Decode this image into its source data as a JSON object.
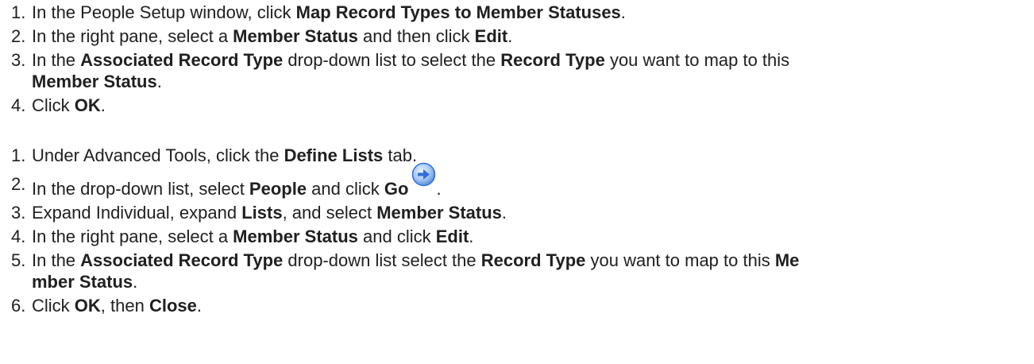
{
  "procedure_1": {
    "step_1": {
      "num": "1.",
      "a": "In the People Setup window, click ",
      "b1": "Map Record Types to Member Statuses",
      "c": "."
    },
    "step_2": {
      "num": "2.",
      "a": "In the right pane, select a ",
      "b1": "Member Status",
      "c": " and then click ",
      "b2": "Edit",
      "d": "."
    },
    "step_3": {
      "num": "3.",
      "a": "In the ",
      "b1": "Associated Record Type",
      "c": " drop-down list to select the ",
      "b2": "Record Type",
      "d": " you want to map to this ",
      "b3": "Member Status",
      "e": "."
    },
    "step_4": {
      "num": "4.",
      "a": "Click ",
      "b1": "OK",
      "c": "."
    }
  },
  "procedure_2": {
    "step_1": {
      "num": "1.",
      "a": "Under Advanced Tools, click the ",
      "b1": "Define Lists",
      "c": " tab."
    },
    "step_2": {
      "num": "2.",
      "a": "In the drop-down list, select ",
      "b1": "People",
      "c": " and click ",
      "b2": "Go",
      "d": "."
    },
    "step_3": {
      "num": "3.",
      "a": "Expand Individual, expand ",
      "b1": "Lists",
      "c": ", and select ",
      "b2": "Member Status",
      "d": "."
    },
    "step_4": {
      "num": "4.",
      "a": "In the right pane, select a ",
      "b1": "Member Status",
      "c": " and click ",
      "b2": "Edit",
      "d": "."
    },
    "step_5": {
      "num": "5.",
      "a": "In the ",
      "b1": "Associated Record Type",
      "c": " drop-down list select the ",
      "b2": "Record Type",
      "d": " you want to map to this ",
      "b3": "Me",
      "e": "mber Status",
      "f": "."
    },
    "step_6": {
      "num": "6.",
      "a": "Click ",
      "b1": "OK",
      "c": ", then ",
      "b2": "Close",
      "d": "."
    }
  },
  "icons": {
    "go": "go-arrow-icon"
  },
  "colors": {
    "text": "#202020",
    "icon_blue": "#2f6fd6"
  }
}
